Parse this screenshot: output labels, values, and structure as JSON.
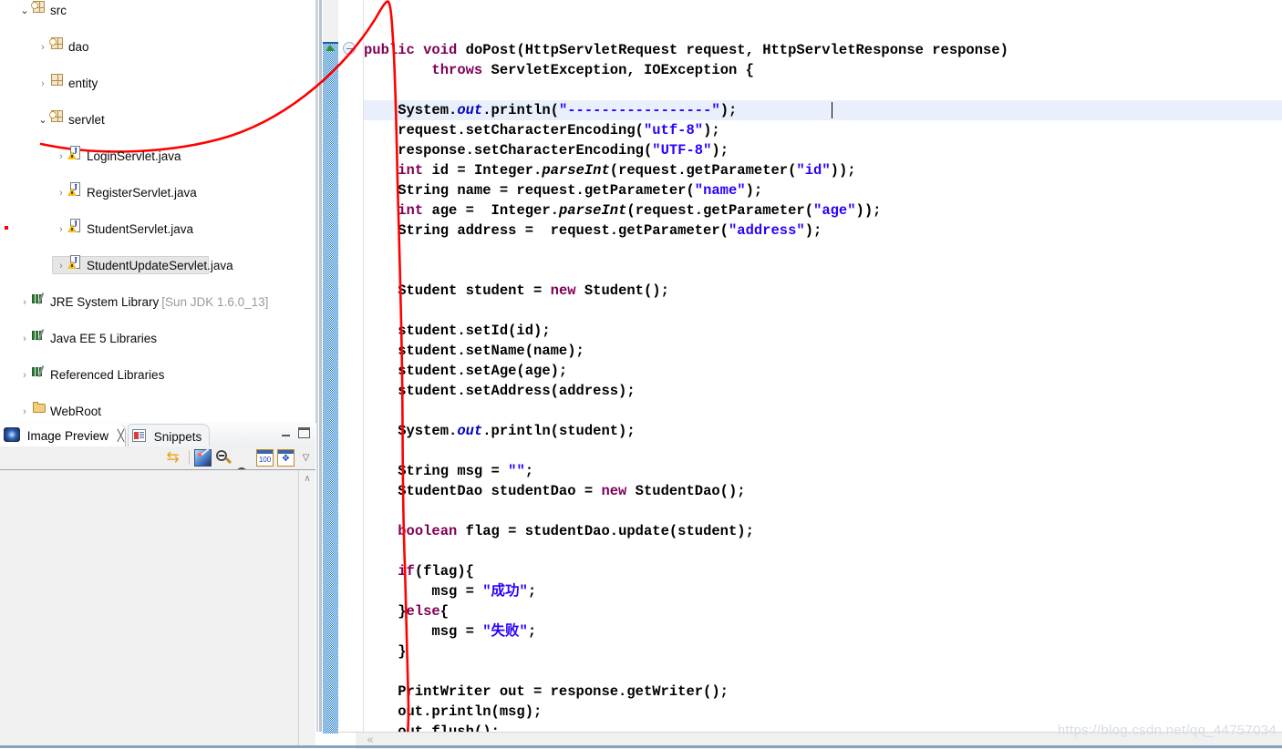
{
  "app": {
    "kind": "eclipse-ide",
    "accent_color": "#2a00ff",
    "keyword_color": "#7f0055",
    "annotation_color": "#ff0000",
    "selection_color": "#e6e6e6",
    "highlight_line_color": "#e9f0fb"
  },
  "package_explorer": {
    "name": "Package Explorer tree",
    "items": [
      {
        "label": "src",
        "icon": "source-folder-icon",
        "indent": 0,
        "twisty": "open",
        "selected": false,
        "suffix": ""
      },
      {
        "label": "dao",
        "icon": "package-icon",
        "indent": 1,
        "twisty": "closed",
        "selected": false,
        "suffix": ""
      },
      {
        "label": "entity",
        "icon": "package-empty-icon",
        "indent": 1,
        "twisty": "closed",
        "selected": false,
        "suffix": ""
      },
      {
        "label": "servlet",
        "icon": "package-icon",
        "indent": 1,
        "twisty": "open",
        "selected": false,
        "suffix": ""
      },
      {
        "label": "LoginServlet.java",
        "icon": "java-file-warning-icon",
        "indent": 2,
        "twisty": "closed",
        "selected": false,
        "suffix": ""
      },
      {
        "label": "RegisterServlet.java",
        "icon": "java-file-warning-icon",
        "indent": 2,
        "twisty": "closed",
        "selected": false,
        "suffix": ""
      },
      {
        "label": "StudentServlet.java",
        "icon": "java-file-warning-icon",
        "indent": 2,
        "twisty": "closed",
        "selected": false,
        "suffix": ""
      },
      {
        "label": "StudentUpdateServlet.java",
        "icon": "java-file-warning-icon",
        "indent": 2,
        "twisty": "closed",
        "selected": true,
        "suffix": ""
      },
      {
        "label": "JRE System Library",
        "icon": "library-icon",
        "indent": 0,
        "twisty": "closed",
        "selected": false,
        "suffix": "[Sun JDK 1.6.0_13]"
      },
      {
        "label": "Java EE 5 Libraries",
        "icon": "library-icon",
        "indent": 0,
        "twisty": "closed",
        "selected": false,
        "suffix": ""
      },
      {
        "label": "Referenced Libraries",
        "icon": "library-icon",
        "indent": 0,
        "twisty": "closed",
        "selected": false,
        "suffix": ""
      },
      {
        "label": "WebRoot",
        "icon": "folder-icon",
        "indent": 0,
        "twisty": "closed",
        "selected": false,
        "suffix": ""
      }
    ]
  },
  "preview_view": {
    "tabs": [
      {
        "label": "Image Preview",
        "icon": "image-preview-icon",
        "active": true,
        "closable": true
      },
      {
        "label": "Snippets",
        "icon": "snippets-icon",
        "active": false,
        "closable": false
      }
    ],
    "window_buttons": [
      {
        "name": "minimize-view-button",
        "glyph": "minimize-icon"
      },
      {
        "name": "maximize-view-button",
        "glyph": "maximize-icon"
      }
    ],
    "toolbar": [
      {
        "name": "sync-button",
        "icon": "sync-arrows-icon",
        "glyph": "⇆"
      },
      {
        "name": "separator",
        "icon": "toolbar-separator",
        "glyph": ""
      },
      {
        "name": "open-image-button",
        "icon": "image-icon",
        "glyph": ""
      },
      {
        "name": "zoom-out-button",
        "icon": "zoom-out-icon",
        "glyph": ""
      },
      {
        "name": "zoom-in-button",
        "icon": "zoom-in-icon",
        "glyph": ""
      },
      {
        "name": "actual-size-button",
        "icon": "zoom-100-icon",
        "glyph": "100"
      },
      {
        "name": "fit-window-button",
        "icon": "fit-to-window-icon",
        "glyph": "✥"
      },
      {
        "name": "view-menu-button",
        "icon": "chevron-down-icon",
        "glyph": "▽"
      }
    ],
    "scroll_up_glyph": "∧"
  },
  "editor": {
    "overview_ruler": {
      "name": "overview-ruler",
      "marker": "up-arrow-marker"
    },
    "fold_marker": "collapse-fold-icon",
    "highlighted_line_index": 3,
    "caret_line": 3,
    "horizontal_scroll_glyph": "«",
    "code_lines": [
      [
        {
          "t": "public ",
          "c": "kw"
        },
        {
          "t": "void ",
          "c": "kw"
        },
        {
          "t": "doPost(HttpServletRequest request, HttpServletResponse response)",
          "c": ""
        }
      ],
      [
        {
          "t": "        ",
          "c": ""
        },
        {
          "t": "throws ",
          "c": "kw"
        },
        {
          "t": "ServletException, IOException {",
          "c": ""
        }
      ],
      [
        {
          "t": "",
          "c": ""
        }
      ],
      [
        {
          "t": "    System.",
          "c": ""
        },
        {
          "t": "out",
          "c": "fld"
        },
        {
          "t": ".println(",
          "c": ""
        },
        {
          "t": "\"-----------------\"",
          "c": "str"
        },
        {
          "t": ");",
          "c": ""
        }
      ],
      [
        {
          "t": "    request.setCharacterEncoding(",
          "c": ""
        },
        {
          "t": "\"utf-8\"",
          "c": "str"
        },
        {
          "t": ");",
          "c": ""
        }
      ],
      [
        {
          "t": "    response.setCharacterEncoding(",
          "c": ""
        },
        {
          "t": "\"UTF-8\"",
          "c": "str"
        },
        {
          "t": ");",
          "c": ""
        }
      ],
      [
        {
          "t": "    ",
          "c": ""
        },
        {
          "t": "int ",
          "c": "kw"
        },
        {
          "t": "id = Integer.",
          "c": ""
        },
        {
          "t": "parseInt",
          "c": "mth"
        },
        {
          "t": "(request.getParameter(",
          "c": ""
        },
        {
          "t": "\"id\"",
          "c": "str"
        },
        {
          "t": "));",
          "c": ""
        }
      ],
      [
        {
          "t": "    String name = request.getParameter(",
          "c": ""
        },
        {
          "t": "\"name\"",
          "c": "str"
        },
        {
          "t": ");",
          "c": ""
        }
      ],
      [
        {
          "t": "    ",
          "c": ""
        },
        {
          "t": "int ",
          "c": "kw"
        },
        {
          "t": "age =  Integer.",
          "c": ""
        },
        {
          "t": "parseInt",
          "c": "mth"
        },
        {
          "t": "(request.getParameter(",
          "c": ""
        },
        {
          "t": "\"age\"",
          "c": "str"
        },
        {
          "t": "));",
          "c": ""
        }
      ],
      [
        {
          "t": "    String address =  request.getParameter(",
          "c": ""
        },
        {
          "t": "\"address\"",
          "c": "str"
        },
        {
          "t": ");",
          "c": ""
        }
      ],
      [
        {
          "t": "",
          "c": ""
        }
      ],
      [
        {
          "t": "",
          "c": ""
        }
      ],
      [
        {
          "t": "    Student student = ",
          "c": ""
        },
        {
          "t": "new ",
          "c": "kw"
        },
        {
          "t": "Student();",
          "c": ""
        }
      ],
      [
        {
          "t": "",
          "c": ""
        }
      ],
      [
        {
          "t": "    student.setId(id);",
          "c": ""
        }
      ],
      [
        {
          "t": "    student.setName(name);",
          "c": ""
        }
      ],
      [
        {
          "t": "    student.setAge(age);",
          "c": ""
        }
      ],
      [
        {
          "t": "    student.setAddress(address);",
          "c": ""
        }
      ],
      [
        {
          "t": "",
          "c": ""
        }
      ],
      [
        {
          "t": "    System.",
          "c": ""
        },
        {
          "t": "out",
          "c": "fld"
        },
        {
          "t": ".println(student);",
          "c": ""
        }
      ],
      [
        {
          "t": "",
          "c": ""
        }
      ],
      [
        {
          "t": "    String msg = ",
          "c": ""
        },
        {
          "t": "\"\"",
          "c": "str"
        },
        {
          "t": ";",
          "c": ""
        }
      ],
      [
        {
          "t": "    StudentDao studentDao = ",
          "c": ""
        },
        {
          "t": "new ",
          "c": "kw"
        },
        {
          "t": "StudentDao();",
          "c": ""
        }
      ],
      [
        {
          "t": "",
          "c": ""
        }
      ],
      [
        {
          "t": "    ",
          "c": ""
        },
        {
          "t": "boolean ",
          "c": "kw"
        },
        {
          "t": "flag = studentDao.update(student);",
          "c": ""
        }
      ],
      [
        {
          "t": "",
          "c": ""
        }
      ],
      [
        {
          "t": "    ",
          "c": ""
        },
        {
          "t": "if",
          "c": "kw"
        },
        {
          "t": "(flag){",
          "c": ""
        }
      ],
      [
        {
          "t": "        msg = ",
          "c": ""
        },
        {
          "t": "\"成功\"",
          "c": "str"
        },
        {
          "t": ";",
          "c": ""
        }
      ],
      [
        {
          "t": "    }",
          "c": ""
        },
        {
          "t": "else",
          "c": "kw"
        },
        {
          "t": "{",
          "c": ""
        }
      ],
      [
        {
          "t": "        msg = ",
          "c": ""
        },
        {
          "t": "\"失败\"",
          "c": "str"
        },
        {
          "t": ";",
          "c": ""
        }
      ],
      [
        {
          "t": "    }",
          "c": ""
        }
      ],
      [
        {
          "t": "",
          "c": ""
        }
      ],
      [
        {
          "t": "    PrintWriter out = response.getWriter();",
          "c": ""
        }
      ],
      [
        {
          "t": "    out.println(msg);",
          "c": ""
        }
      ],
      [
        {
          "t": "    out.flush();",
          "c": ""
        }
      ]
    ]
  },
  "watermark": {
    "text": "https://blog.csdn.net/qq_44757034"
  }
}
